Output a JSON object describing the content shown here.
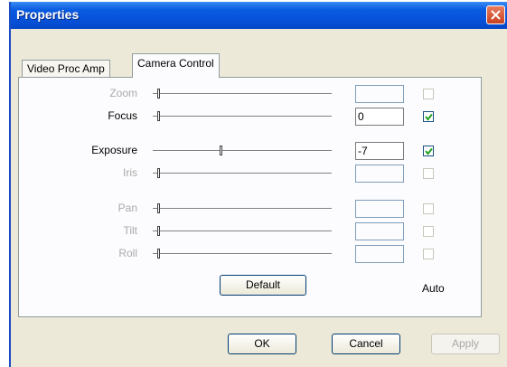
{
  "window": {
    "title": "Properties"
  },
  "tabs": [
    {
      "label": "Video Proc Amp",
      "active": false
    },
    {
      "label": "Camera Control",
      "active": true
    }
  ],
  "controls": [
    {
      "label": "Zoom",
      "enabled": false,
      "value": "",
      "auto": false
    },
    {
      "label": "Focus",
      "enabled": true,
      "value": "0",
      "auto": true
    },
    {
      "label": "Exposure",
      "enabled": true,
      "value": "-7",
      "auto": true
    },
    {
      "label": "Iris",
      "enabled": false,
      "value": "",
      "auto": false
    },
    {
      "label": "Pan",
      "enabled": false,
      "value": "",
      "auto": false
    },
    {
      "label": "Tilt",
      "enabled": false,
      "value": "",
      "auto": false
    },
    {
      "label": "Roll",
      "enabled": false,
      "value": "",
      "auto": false
    }
  ],
  "default_button": "Default",
  "auto_label": "Auto",
  "buttons": {
    "ok": "OK",
    "cancel": "Cancel",
    "apply": "Apply"
  },
  "colors": {
    "titlebar": "#0651d8",
    "close": "#c8411f",
    "dialog": "#ece9d8",
    "panel": "#fcfcfe"
  }
}
